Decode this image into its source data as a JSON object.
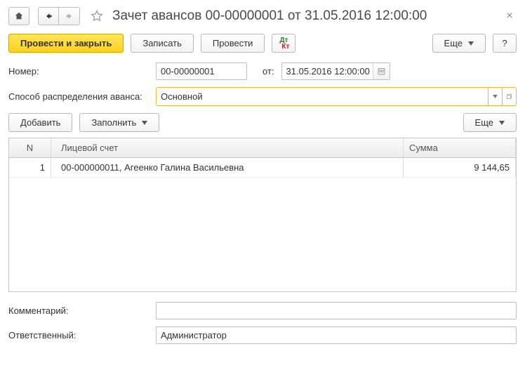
{
  "titlebar": {
    "title": "Зачет авансов 00-00000001 от 31.05.2016 12:00:00"
  },
  "toolbar": {
    "post_close": "Провести и закрыть",
    "save": "Записать",
    "post": "Провести",
    "more": "Еще",
    "help": "?"
  },
  "fields": {
    "number_label": "Номер:",
    "number_value": "00-00000001",
    "from_label": "от:",
    "date_value": "31.05.2016 12:00:00",
    "method_label": "Способ распределения аванса:",
    "method_value": "Основной",
    "comment_label": "Комментарий:",
    "comment_value": "",
    "responsible_label": "Ответственный:",
    "responsible_value": "Администратор"
  },
  "table_toolbar": {
    "add": "Добавить",
    "fill": "Заполнить",
    "more": "Еще"
  },
  "table": {
    "columns": {
      "n": "N",
      "acc": "Лицевой счет",
      "sum": "Сумма"
    },
    "rows": [
      {
        "n": "1",
        "acc": "00-000000011, Агеенко Галина Васильевна",
        "sum": "9 144,65"
      }
    ]
  }
}
